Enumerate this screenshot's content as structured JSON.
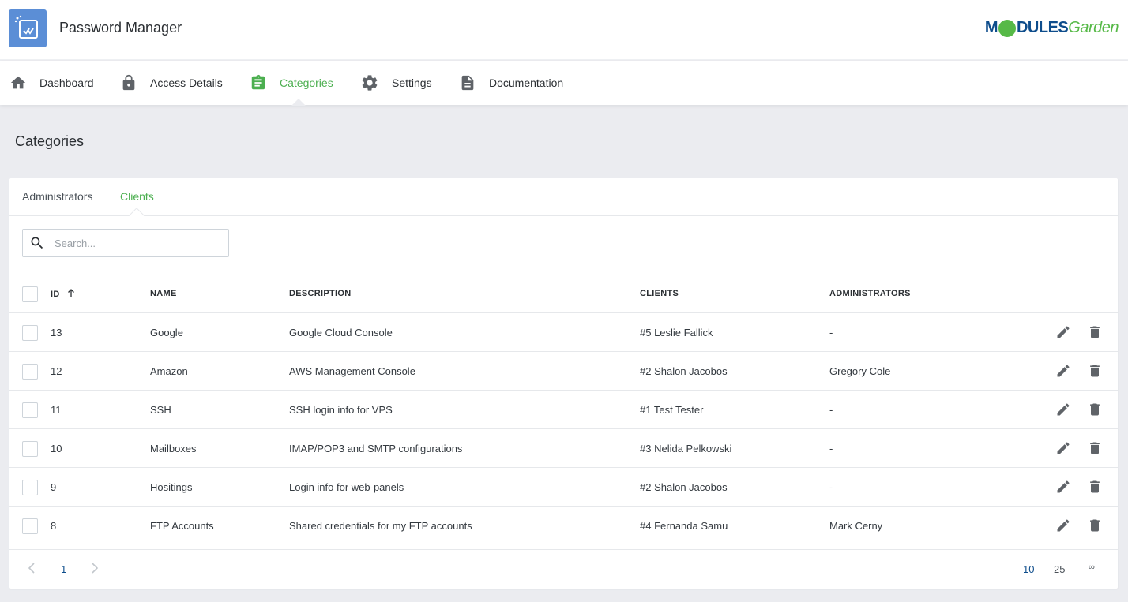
{
  "app": {
    "title": "Password Manager",
    "brand_prefix": "M",
    "brand_mid": "DULES",
    "brand_suffix": "Garden"
  },
  "nav": {
    "items": [
      {
        "label": "Dashboard",
        "icon": "home-icon"
      },
      {
        "label": "Access Details",
        "icon": "lock-icon"
      },
      {
        "label": "Categories",
        "icon": "clipboard-icon",
        "active": true
      },
      {
        "label": "Settings",
        "icon": "gear-icon"
      },
      {
        "label": "Documentation",
        "icon": "document-icon"
      }
    ]
  },
  "page": {
    "title": "Categories"
  },
  "tabs": [
    {
      "label": "Administrators"
    },
    {
      "label": "Clients",
      "active": true
    }
  ],
  "search": {
    "placeholder": "Search...",
    "value": ""
  },
  "table": {
    "columns": [
      "ID",
      "NAME",
      "DESCRIPTION",
      "CLIENTS",
      "ADMINISTRATORS"
    ],
    "sort_column": "ID",
    "sort_direction": "ascending-arrow",
    "rows": [
      {
        "id": "13",
        "name": "Google",
        "description": "Google Cloud Console",
        "clients": "#5 Leslie Fallick",
        "administrators": "-"
      },
      {
        "id": "12",
        "name": "Amazon",
        "description": "AWS Management Console",
        "clients": "#2 Shalon Jacobos",
        "administrators": "Gregory Cole"
      },
      {
        "id": "11",
        "name": "SSH",
        "description": "SSH login info for VPS",
        "clients": "#1 Test Tester",
        "administrators": "-"
      },
      {
        "id": "10",
        "name": "Mailboxes",
        "description": "IMAP/POP3 and SMTP configurations",
        "clients": "#3 Nelida Pelkowski",
        "administrators": "-"
      },
      {
        "id": "9",
        "name": "Hositings",
        "description": "Login info for web-panels",
        "clients": "#2 Shalon Jacobos",
        "administrators": "-"
      },
      {
        "id": "8",
        "name": "FTP Accounts",
        "description": "Shared credentials for my FTP accounts",
        "clients": "#4 Fernanda Samu",
        "administrators": "Mark Cerny"
      }
    ]
  },
  "pagination": {
    "current_page": "1",
    "page_sizes": [
      "10",
      "25",
      "∞"
    ],
    "selected_page_size": "10"
  },
  "colors": {
    "accent": "#4caf50",
    "link": "#0e4d8c",
    "background": "#ebecf0"
  }
}
